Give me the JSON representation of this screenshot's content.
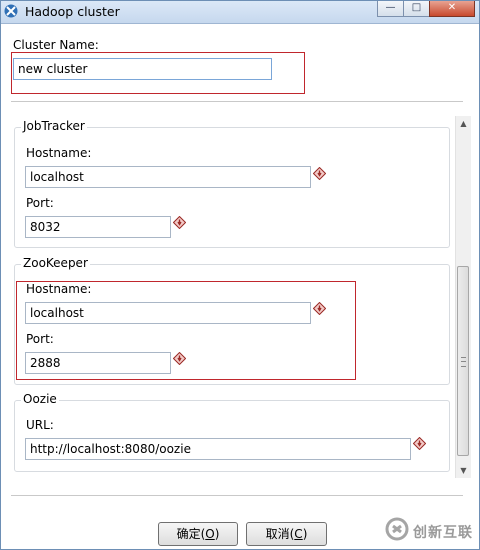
{
  "window": {
    "title": "Hadoop cluster"
  },
  "cluster": {
    "name_label": "Cluster Name:",
    "name_value": "new cluster"
  },
  "jobtracker": {
    "legend": "JobTracker",
    "hostname_label": "Hostname:",
    "hostname_value": "localhost",
    "port_label": "Port:",
    "port_value": "8032"
  },
  "zookeeper": {
    "legend": "ZooKeeper",
    "hostname_label": "Hostname:",
    "hostname_value": "localhost",
    "port_label": "Port:",
    "port_value": "2888"
  },
  "oozie": {
    "legend": "Oozie",
    "url_label": "URL:",
    "url_value": "http://localhost:8080/oozie"
  },
  "buttons": {
    "ok": {
      "text": "确定(",
      "mnemonic": "O",
      "end": ")"
    },
    "cancel": {
      "text": "取消(",
      "mnemonic": "C",
      "end": ")"
    }
  },
  "watermark": {
    "text": "创新互联"
  },
  "colors": {
    "highlight_box": "#c0272d",
    "titlebar": "#c6d8ee",
    "required_marker": "#c0272d"
  }
}
